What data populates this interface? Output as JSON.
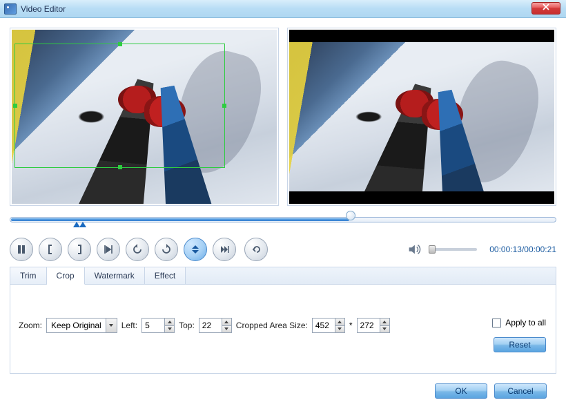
{
  "window": {
    "title": "Video Editor"
  },
  "toolbar": {
    "buttons": {
      "pause": "pause",
      "bracket_open": "start-bracket",
      "bracket_close": "end-bracket",
      "play_range": "play-range",
      "rotate_left": "rotate-left",
      "rotate_right": "rotate-right",
      "flip_v": "flip-vertical",
      "next_frame": "next-frame",
      "undo": "undo"
    }
  },
  "timeline": {
    "current": "00:00:13",
    "total": "00:00:21",
    "progress_percent": 61.9
  },
  "tabs": {
    "items": [
      "Trim",
      "Crop",
      "Watermark",
      "Effect"
    ],
    "active_index": 1
  },
  "crop": {
    "zoom_label": "Zoom:",
    "zoom_value": "Keep Original",
    "left_label": "Left:",
    "left_value": "5",
    "top_label": "Top:",
    "top_value": "22",
    "size_label": "Cropped Area Size:",
    "width_value": "452",
    "size_sep": "*",
    "height_value": "272",
    "apply_label": "Apply to all",
    "apply_checked": false,
    "reset_label": "Reset"
  },
  "footer": {
    "ok": "OK",
    "cancel": "Cancel"
  }
}
